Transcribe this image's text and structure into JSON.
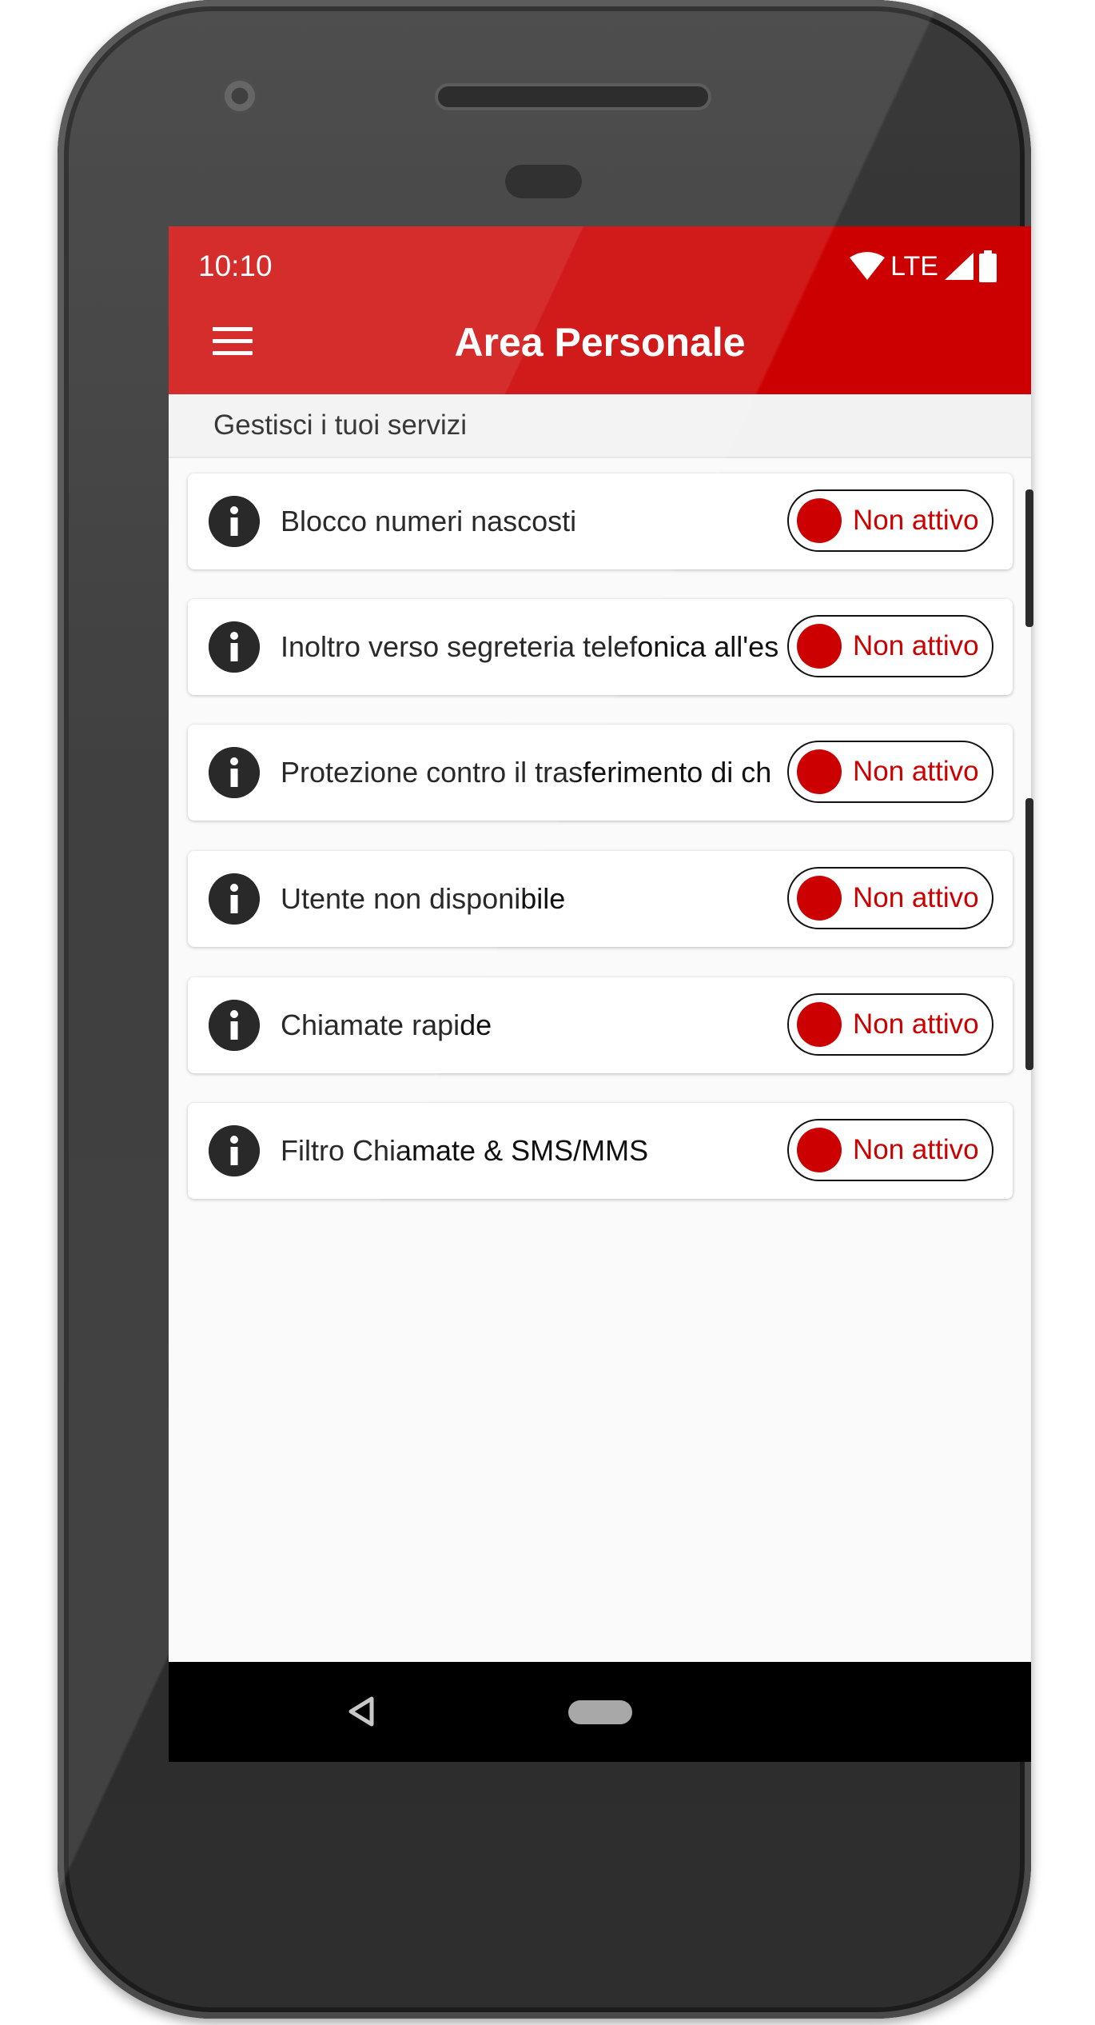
{
  "status_bar": {
    "time": "10:10",
    "network": "LTE"
  },
  "app_bar": {
    "title": "Area Personale",
    "menu_icon": "hamburger-menu-icon"
  },
  "section": {
    "header": "Gestisci i tuoi servizi"
  },
  "services": [
    {
      "label": "Blocco numeri nascosti",
      "status": "Non attivo"
    },
    {
      "label": "Inoltro verso segreteria telefonica all'es",
      "status": "Non attivo"
    },
    {
      "label": "Protezione contro il trasferimento di ch",
      "status": "Non attivo"
    },
    {
      "label": "Utente non disponibile",
      "status": "Non attivo"
    },
    {
      "label": "Chiamate rapide",
      "status": "Non attivo"
    },
    {
      "label": "Filtro Chiamate & SMS/MMS",
      "status": "Non attivo"
    }
  ],
  "colors": {
    "accent": "#cc0000",
    "background": "#fafafa",
    "card": "#ffffff",
    "info_icon": "#111111"
  },
  "nav": {
    "back_icon": "back-triangle-icon",
    "home_icon": "home-pill-icon"
  }
}
